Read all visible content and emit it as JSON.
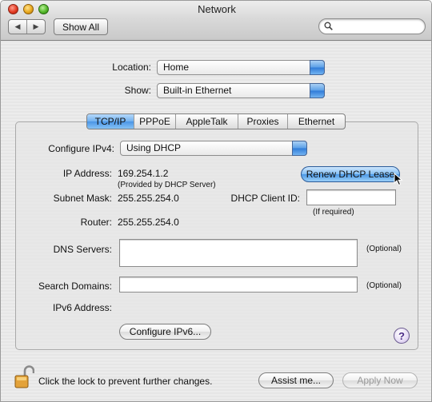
{
  "window": {
    "title": "Network",
    "show_all_label": "Show All",
    "nav_back": "◀",
    "nav_forward": "▶",
    "search_value": ""
  },
  "location": {
    "label": "Location:",
    "value": "Home"
  },
  "show": {
    "label": "Show:",
    "value": "Built-in Ethernet"
  },
  "tabs": [
    {
      "label": "TCP/IP",
      "active": true
    },
    {
      "label": "PPPoE",
      "active": false
    },
    {
      "label": "AppleTalk",
      "active": false
    },
    {
      "label": "Proxies",
      "active": false
    },
    {
      "label": "Ethernet",
      "active": false
    }
  ],
  "tcpip": {
    "configure_label": "Configure IPv4:",
    "configure_value": "Using DHCP",
    "ip_label": "IP Address:",
    "ip_value": "169.254.1.2",
    "ip_note": "(Provided by DHCP Server)",
    "renew_button": "Renew DHCP Lease",
    "subnet_label": "Subnet Mask:",
    "subnet_value": "255.255.254.0",
    "client_id_label": "DHCP Client ID:",
    "client_id_value": "",
    "client_id_note": "(If required)",
    "router_label": "Router:",
    "router_value": "255.255.254.0",
    "dns_label": "DNS Servers:",
    "dns_value": "",
    "dns_note": "(Optional)",
    "search_label": "Search Domains:",
    "search_value": "",
    "search_note": "(Optional)",
    "ipv6_label": "IPv6 Address:",
    "ipv6_value": "",
    "configure_ipv6_button": "Configure IPv6...",
    "help_symbol": "?"
  },
  "footer": {
    "lock_text": "Click the lock to prevent further changes.",
    "assist_button": "Assist me...",
    "apply_button": "Apply Now"
  }
}
